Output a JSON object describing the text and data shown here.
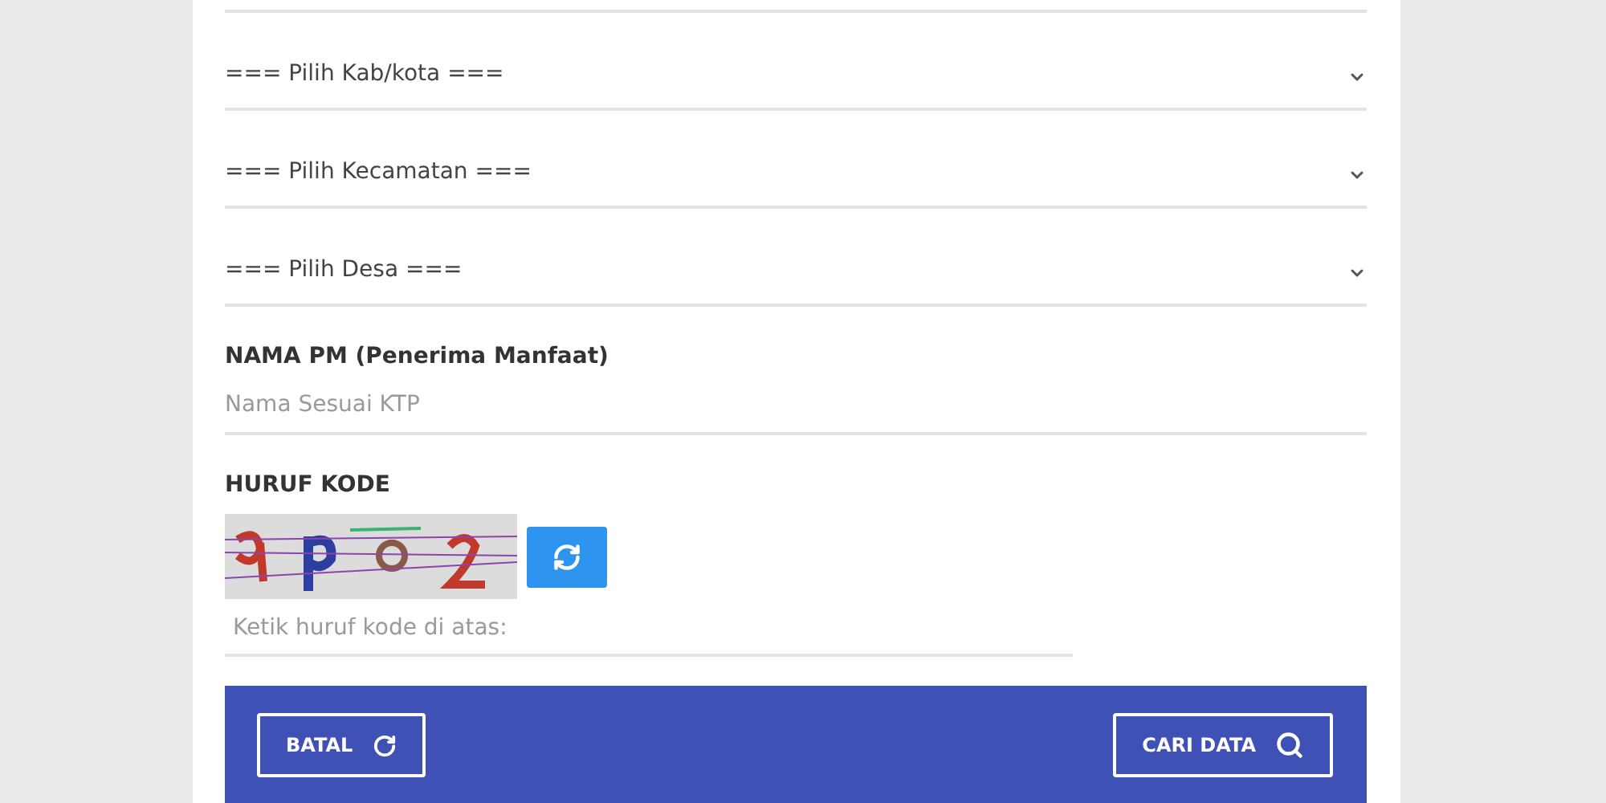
{
  "selects": [
    {
      "placeholder": "=== Pilih Kab/kota ==="
    },
    {
      "placeholder": "=== Pilih Kecamatan ==="
    },
    {
      "placeholder": "=== Pilih Desa ==="
    }
  ],
  "name_field": {
    "label": "NAMA PM (Penerima Manfaat)",
    "placeholder": "Nama Sesuai KTP"
  },
  "captcha": {
    "label": "HURUF KODE",
    "placeholder": "Ketik huruf kode di atas:"
  },
  "footer": {
    "buttons": [
      {
        "label": "BATAL",
        "kind": "reset"
      },
      {
        "label": "CARI DATA",
        "kind": "search"
      }
    ]
  }
}
